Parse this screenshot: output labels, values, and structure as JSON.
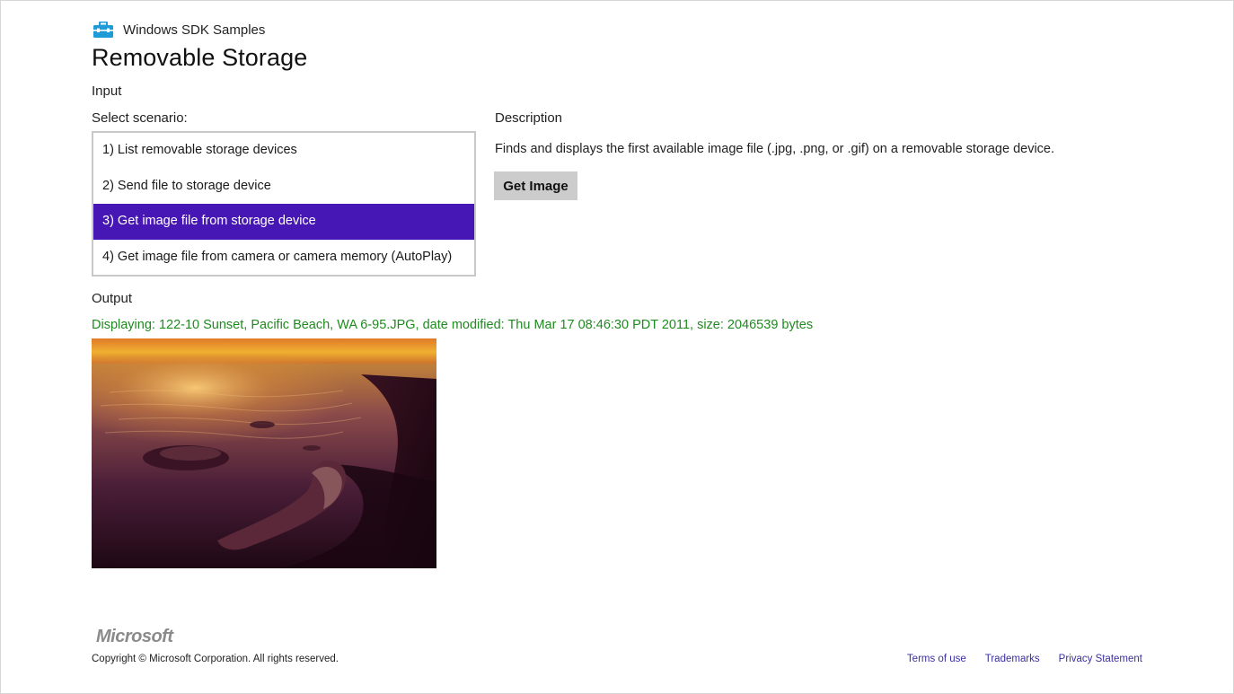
{
  "header": {
    "app_title": "Windows SDK Samples",
    "icon": "toolbox-icon",
    "icon_color": "#1f9bd7"
  },
  "page_title": "Removable Storage",
  "input": {
    "label": "Input",
    "select_label": "Select scenario:",
    "scenarios": [
      "1) List removable storage devices",
      "2) Send file to storage device",
      "3) Get image file from storage device",
      "4) Get image file from camera or camera memory (AutoPlay)"
    ],
    "selected_index": 2,
    "selected_color": "#4617b4"
  },
  "description": {
    "label": "Description",
    "text": "Finds and displays the first available image file (.jpg, .png, or .gif) on a removable storage device.",
    "button_label": "Get Image"
  },
  "output": {
    "label": "Output",
    "status": "Displaying: 122-10 Sunset, Pacific Beach, WA 6-95.JPG, date modified: Thu Mar 17 08:46:30 PDT 2011, size: 2046539 bytes",
    "status_color": "#1f8a1f"
  },
  "footer": {
    "logo_text": "Microsoft",
    "copyright": "Copyright © Microsoft Corporation. All rights reserved.",
    "links": [
      "Terms of use",
      "Trademarks",
      "Privacy Statement"
    ],
    "link_color": "#3a2fa0"
  }
}
